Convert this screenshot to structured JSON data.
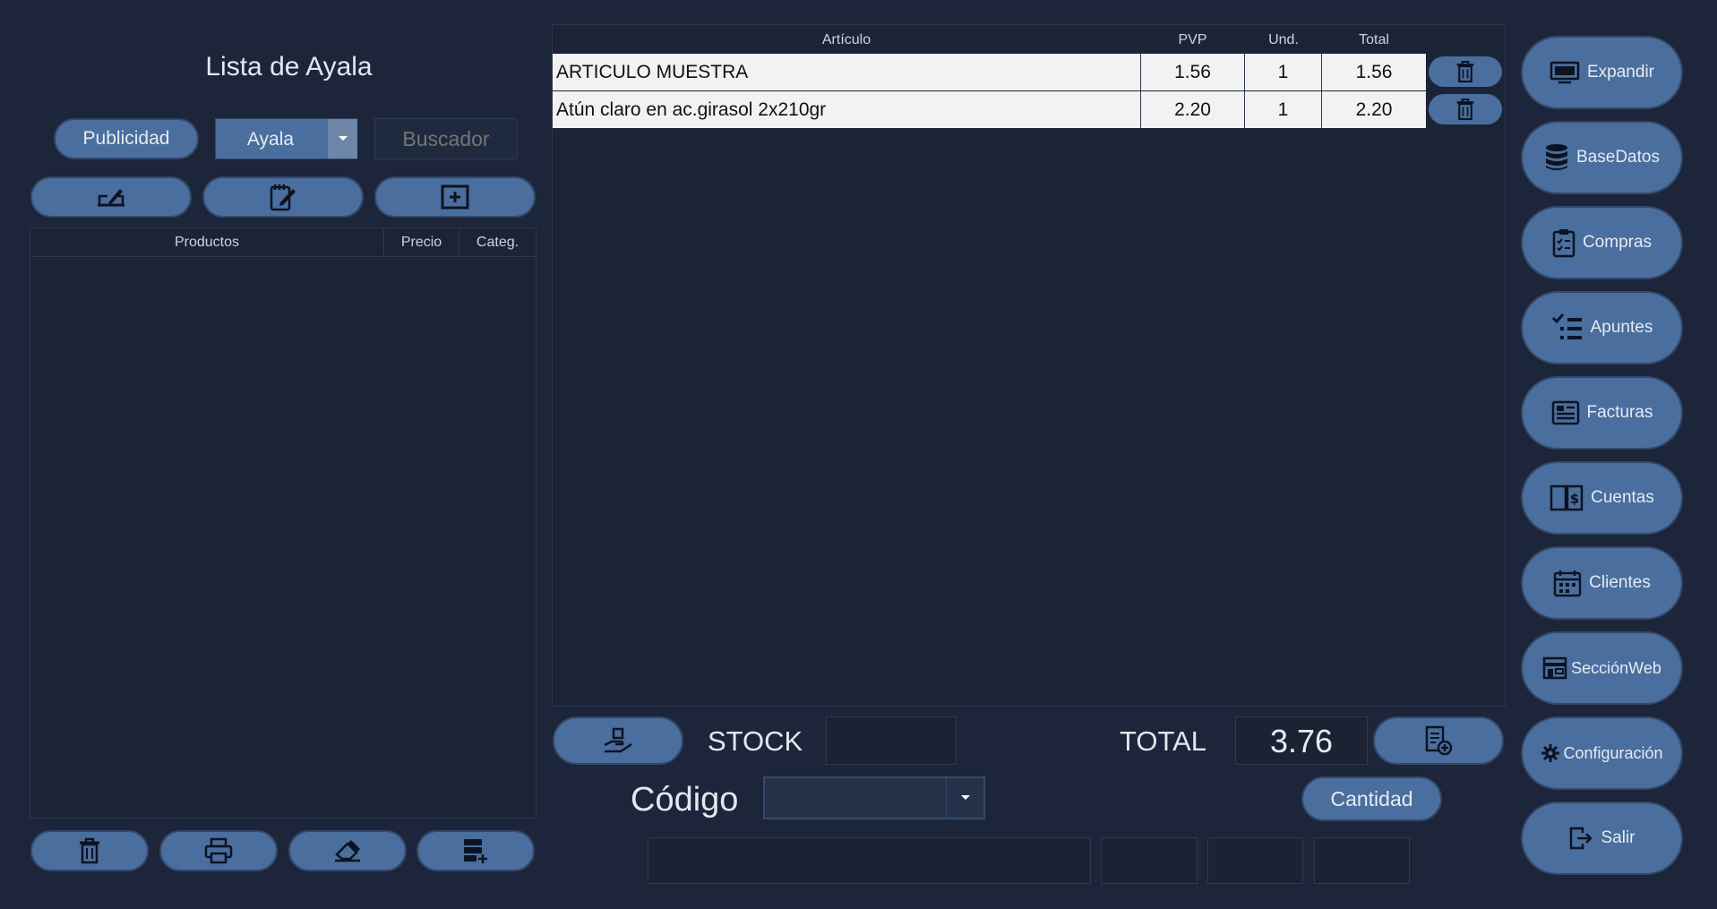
{
  "left_panel": {
    "title": "Lista de Ayala",
    "publicidad_label": "Publicidad",
    "list_select_value": "Ayala",
    "search_placeholder": "Buscador",
    "columns": [
      "Productos",
      "Precio",
      "Categ."
    ],
    "rows": []
  },
  "cart": {
    "columns": [
      "Artículo",
      "PVP",
      "Und.",
      "Total"
    ],
    "rows": [
      {
        "articulo": "ARTICULO MUESTRA",
        "pvp": "1.56",
        "und": "1",
        "total": "1.56"
      },
      {
        "articulo": "Atún claro en ac.girasol 2x210gr",
        "pvp": "2.20",
        "und": "1",
        "total": "2.20"
      }
    ]
  },
  "bottom": {
    "stock_label": "STOCK",
    "stock_value": "",
    "total_label": "TOTAL",
    "total_value": "3.76",
    "codigo_label": "Código",
    "codigo_value": "",
    "cantidad_label": "Cantidad"
  },
  "sidebar": {
    "items": [
      {
        "label": "Expandir",
        "icon": "monitor-icon"
      },
      {
        "label": "BaseDatos",
        "icon": "database-icon"
      },
      {
        "label": "Compras",
        "icon": "clipboard-icon"
      },
      {
        "label": "Apuntes",
        "icon": "checklist-icon"
      },
      {
        "label": "Facturas",
        "icon": "invoice-icon"
      },
      {
        "label": "Cuentas",
        "icon": "accounts-book-icon"
      },
      {
        "label": "Clientes",
        "icon": "calendar-icon"
      },
      {
        "label": "SecciónWeb",
        "icon": "web-store-icon"
      },
      {
        "label": "Configuración",
        "icon": "gears-icon"
      },
      {
        "label": "Salir",
        "icon": "exit-icon"
      }
    ]
  },
  "colors": {
    "background": "#1c2539",
    "button": "#4a6e9d",
    "panel": "#1b2437",
    "row": "#f2f2f2"
  }
}
